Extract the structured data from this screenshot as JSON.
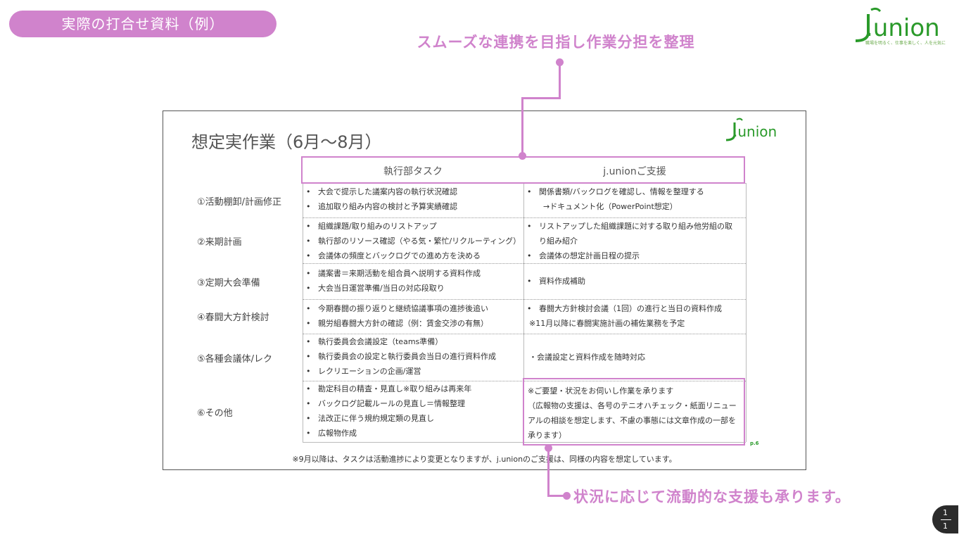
{
  "header": {
    "pill_label": "実際の打合せ資料（例）",
    "headline": "スムーズな連携を目指し作業分担を整理",
    "footnote": "状況に応じて流動的な支援も承ります。"
  },
  "logo": {
    "word": "j.union",
    "tagline": "職場を明るく、仕事を楽しく、人を元気に"
  },
  "slide": {
    "title": "想定実作業（6月〜8月）",
    "columns": [
      "執行部タスク",
      "j.unionご支援"
    ],
    "rows": [
      {
        "label": "①活動棚卸/計画修正",
        "tasks": [
          "大会で提示した議案内容の執行状況確認",
          "追加取り組み内容の検討と予算実績確認"
        ],
        "support": [
          "関係書類/バックログを確認し、情報を整理する",
          "→ドキュメント化（PowerPoint想定）"
        ]
      },
      {
        "label": "②来期計画",
        "tasks": [
          "組織課題/取り組みのリストアップ",
          "執行部のリソース確認（やる気・繁忙/リクルーティング）",
          "会議体の頻度とバックログでの進め方を決める"
        ],
        "support": [
          "リストアップした組織課題に対する取り組み他労組の取り組み紹介",
          "会議体の想定計画日程の提示"
        ]
      },
      {
        "label": "③定期大会準備",
        "tasks": [
          "議案書＝来期活動を組合員へ説明する資料作成",
          "大会当日運営準備/当日の対応段取り"
        ],
        "support": [
          "資料作成補助"
        ]
      },
      {
        "label": "④春闘大方針検討",
        "tasks": [
          "今期春闘の振り返りと継続協議事項の進捗後追い",
          "親労組春闘大方針の確認（例：賃金交渉の有無）"
        ],
        "support": [
          "春闘大方針検討会議（1回）の進行と当日の資料作成",
          "※11月以降に春闘実施計画の補佐業務を予定"
        ]
      },
      {
        "label": "⑤各種会議体/レク",
        "tasks": [
          "執行委員会会議設定（teams準備）",
          "執行委員会の設定と執行委員会当日の進行資料作成",
          "レクリエーションの企画/運営"
        ],
        "support": [
          "・会議設定と資料作成を随時対応"
        ]
      },
      {
        "label": "⑥その他",
        "tasks": [
          "勘定科目の精査・見直し※取り組みは再来年",
          "バックログ記載ルールの見直し＝情報整理",
          "法改正に伴う規約規定類の見直し",
          "広報物作成"
        ],
        "support": [
          "※ご要望・状況をお伺いし作業を承ります",
          "（広報物の支援は、各号のテニオハチェック・紙面リニューアルの相談を想定します、不慮の事態には文章作成の一部を承ります）"
        ]
      }
    ],
    "page_no": "p.6",
    "bottom_note": "※9月以降は、タスクは活動進捗により変更となりますが、j.unionのご支援は、同様の内容を想定しています。"
  },
  "pager": {
    "top": "1",
    "bottom": "1"
  },
  "colors": {
    "accent_pink": "#d083cc",
    "brand_green": "#2a9a2a"
  }
}
